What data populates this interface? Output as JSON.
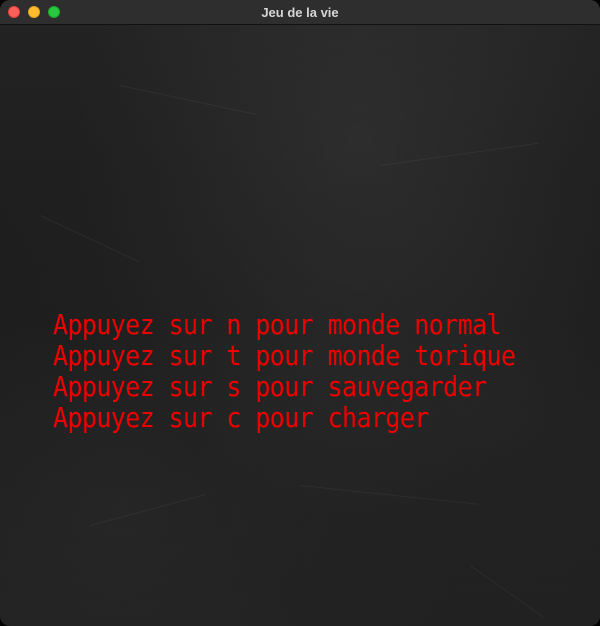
{
  "window": {
    "title": "Jeu de la vie"
  },
  "menu": {
    "text_color": "#ee0000",
    "lines": [
      "Appuyez sur n pour monde normal",
      "Appuyez sur t pour monde torique",
      "Appuyez sur s pour sauvegarder",
      "Appuyez sur c pour charger"
    ]
  },
  "icons": {
    "close": "close-icon",
    "minimize": "minimize-icon",
    "maximize": "maximize-icon"
  }
}
